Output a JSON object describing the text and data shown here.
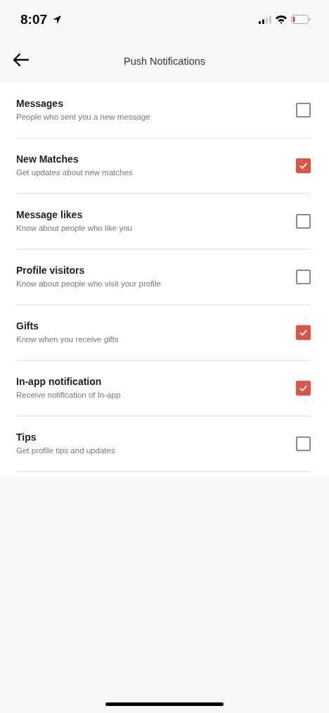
{
  "status_bar": {
    "time": "8:07"
  },
  "header": {
    "title": "Push Notifications"
  },
  "settings": [
    {
      "title": "Messages",
      "subtitle": "People who sent you a new message",
      "checked": false
    },
    {
      "title": "New Matches",
      "subtitle": "Get updates about new matches",
      "checked": true
    },
    {
      "title": "Message likes",
      "subtitle": "Know about people who like you",
      "checked": false
    },
    {
      "title": "Profile visitors",
      "subtitle": "Know about people who visit your profile",
      "checked": false
    },
    {
      "title": "Gifts",
      "subtitle": "Know when you receive gifts",
      "checked": true
    },
    {
      "title": "In-app notification",
      "subtitle": "Receive notification of In-app",
      "checked": true
    },
    {
      "title": "Tips",
      "subtitle": "Get profile tips and updates",
      "checked": false
    }
  ]
}
